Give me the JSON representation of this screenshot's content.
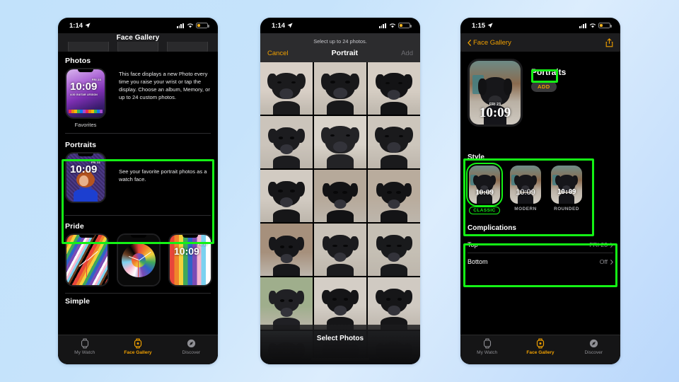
{
  "background": {
    "color_start": "#c2e2fb",
    "color_end": "#b9d7fb"
  },
  "accent": {
    "orange": "#f0a000",
    "highlight_green": "#14f215"
  },
  "phone1": {
    "status": {
      "time": "1:14",
      "location_icon": "location-arrow-icon",
      "signal_icon": "cellular-signal-icon",
      "wifi_icon": "wifi-icon",
      "battery_icon": "battery-low-icon"
    },
    "nav_title": "Face Gallery",
    "sections": [
      {
        "title": "Photos",
        "face_caption": "Favorites",
        "face_time": "10:09",
        "face_date": "FRI 23",
        "face_sub": "4:30 GUITAR LESSON",
        "description": "This face displays a new Photo every time you raise your wrist or tap the display. Choose an album, Memory, or up to 24 custom photos."
      },
      {
        "title": "Portraits",
        "face_time": "10:09",
        "face_date": "FRI 23",
        "description": "See your favorite portrait photos as a watch face."
      },
      {
        "title": "Pride",
        "faces": [
          {
            "name": "pride-threads-face"
          },
          {
            "name": "pride-analog-face"
          },
          {
            "name": "pride-digital-face",
            "time": "10:09",
            "date": "FRI 23"
          }
        ]
      },
      {
        "title": "Simple"
      }
    ],
    "tabs": [
      {
        "label": "My Watch",
        "icon": "watch-icon",
        "active": false
      },
      {
        "label": "Face Gallery",
        "icon": "watch-face-icon",
        "active": true
      },
      {
        "label": "Discover",
        "icon": "compass-icon",
        "active": false
      }
    ]
  },
  "phone2": {
    "status": {
      "time": "1:14",
      "location_icon": "location-arrow-icon",
      "signal_icon": "cellular-signal-icon",
      "wifi_icon": "wifi-icon",
      "battery_icon": "battery-low-icon"
    },
    "hint": "Select up to 24 photos.",
    "cancel_label": "Cancel",
    "title": "Portrait",
    "add_label": "Add",
    "select_button": "Select Photos",
    "photo_grid": {
      "columns": 3,
      "rows": 6,
      "photos": [
        {
          "alt": "black-labrador-closeup-1",
          "bg": "#d8cfc6",
          "tone": "#1b1b1d",
          "scale": 1.0,
          "eyes": true
        },
        {
          "alt": "black-labrador-closeup-2",
          "bg": "#cfc7bd",
          "tone": "#18181a",
          "scale": 1.02,
          "eyes": true
        },
        {
          "alt": "black-labrador-closeup-3",
          "bg": "#d5cdc3",
          "tone": "#131315",
          "scale": 0.96,
          "eyes": true
        },
        {
          "alt": "black-labrador-closeup-4",
          "bg": "#cbc4bb",
          "tone": "#1c1c1f",
          "scale": 0.92,
          "eyes": true
        },
        {
          "alt": "black-labrador-closeup-5",
          "bg": "#d9d3ca",
          "tone": "#232326",
          "scale": 1.04,
          "eyes": true
        },
        {
          "alt": "black-labrador-closeup-6",
          "bg": "#cdc6bc",
          "tone": "#1a1a1c",
          "scale": 1.0,
          "eyes": true
        },
        {
          "alt": "black-labrador-closeup-7",
          "bg": "#d2cbc2",
          "tone": "#161618",
          "scale": 0.94,
          "eyes": true
        },
        {
          "alt": "black-labrador-bench-1",
          "bg": "#b6a99a",
          "tone": "#121214",
          "scale": 0.88,
          "eyes": true
        },
        {
          "alt": "black-labrador-bench-2",
          "bg": "#b9ac9d",
          "tone": "#141416",
          "scale": 0.88,
          "eyes": true
        },
        {
          "alt": "black-labrador-bench-3",
          "bg": "#a6907c",
          "tone": "#17171a",
          "scale": 0.86,
          "eyes": true
        },
        {
          "alt": "black-labrador-sidewalk-1",
          "bg": "#c9c2b8",
          "tone": "#1b1b1e",
          "scale": 0.9,
          "eyes": true
        },
        {
          "alt": "black-labrador-sidewalk-2",
          "bg": "#c5bfb4",
          "tone": "#191a1c",
          "scale": 0.9,
          "eyes": true
        },
        {
          "alt": "black-labrador-grass-1",
          "bg": "#9fae8c",
          "tone": "#202024",
          "scale": 0.86,
          "eyes": true
        },
        {
          "alt": "black-labrador-snow-1",
          "bg": "#d4cec6",
          "tone": "#151517",
          "scale": 0.92,
          "eyes": true
        },
        {
          "alt": "black-labrador-snow-2",
          "bg": "#d0cac2",
          "tone": "#161618",
          "scale": 0.92,
          "eyes": true
        },
        {
          "alt": "black-labrador-porch-1",
          "bg": "#5e6b6e",
          "tone": "#1d1d20",
          "scale": 0.94,
          "eyes": true
        },
        {
          "alt": "black-labrador-porch-2",
          "bg": "#2f3a3c",
          "tone": "#171719",
          "scale": 0.96,
          "eyes": true
        },
        {
          "alt": "black-labrador-porch-3",
          "bg": "#3b4447",
          "tone": "#141416",
          "scale": 0.96,
          "eyes": true
        }
      ]
    }
  },
  "phone3": {
    "status": {
      "time": "1:15",
      "location_icon": "location-arrow-icon",
      "signal_icon": "cellular-signal-icon",
      "wifi_icon": "wifi-icon",
      "battery_icon": "battery-low-icon"
    },
    "back_label": "Face Gallery",
    "share_icon": "share-icon",
    "hero": {
      "title": "Portraits",
      "add_label": "ADD",
      "face_time": "10:09",
      "face_date": "FRI 23"
    },
    "style": {
      "title": "Style",
      "options": [
        {
          "label": "CLASSIC",
          "time": "10:09",
          "selected": true
        },
        {
          "label": "MODERN",
          "time": "10:09",
          "selected": false
        },
        {
          "label": "ROUNDED",
          "time": "10:09",
          "selected": false
        }
      ]
    },
    "complications": {
      "title": "Complications",
      "rows": [
        {
          "label": "Top",
          "value": "FRI 23"
        },
        {
          "label": "Bottom",
          "value": "Off"
        }
      ]
    },
    "tabs": [
      {
        "label": "My Watch",
        "icon": "watch-icon",
        "active": false
      },
      {
        "label": "Face Gallery",
        "icon": "watch-face-icon",
        "active": true
      },
      {
        "label": "Discover",
        "icon": "compass-icon",
        "active": false
      }
    ]
  }
}
